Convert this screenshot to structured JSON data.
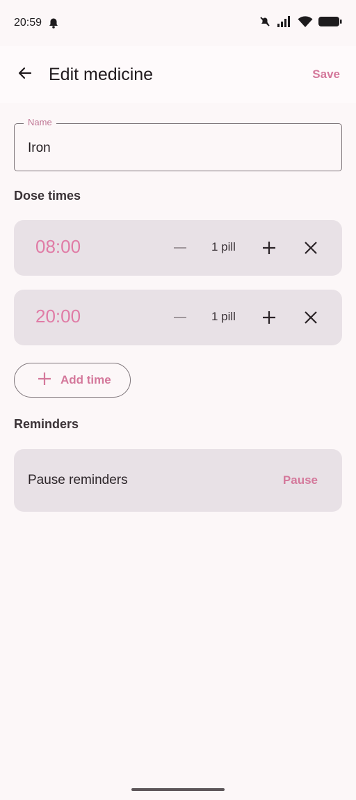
{
  "status_bar": {
    "time": "20:59",
    "left_icon": "notification-bell-icon",
    "right_icons": [
      "mute-icon",
      "signal-icon",
      "wifi-icon",
      "battery-icon"
    ]
  },
  "app_bar": {
    "back_icon": "back-arrow-icon",
    "title": "Edit medicine",
    "save_label": "Save"
  },
  "name_field": {
    "label": "Name",
    "value": "Iron"
  },
  "dose_times": {
    "section_title": "Dose times",
    "items": [
      {
        "time": "08:00",
        "count": "1 pill"
      },
      {
        "time": "20:00",
        "count": "1 pill"
      }
    ],
    "add_label": "Add time"
  },
  "reminders": {
    "section_title": "Reminders",
    "label": "Pause reminders",
    "action_label": "Pause"
  },
  "colors": {
    "accent": "#d4789b",
    "time_text": "#e07ca6",
    "card_bg": "#e8e1e6",
    "page_bg": "#fcf7f8"
  }
}
